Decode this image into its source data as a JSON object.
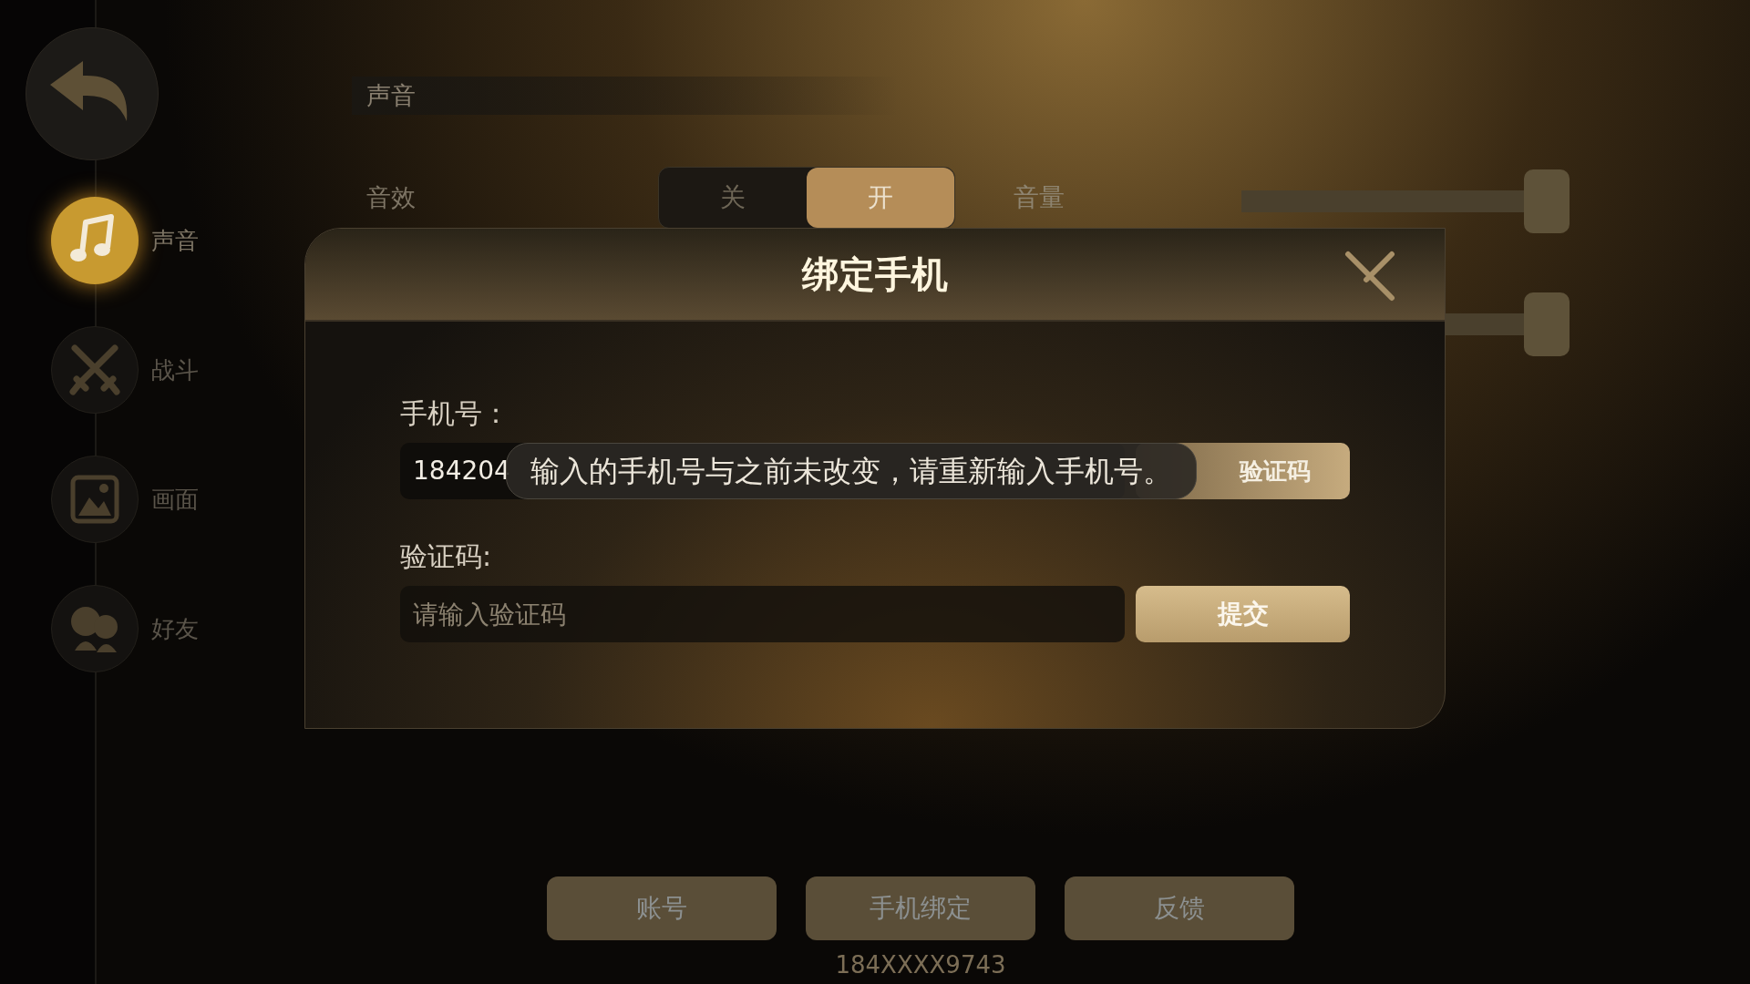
{
  "sidebar": {
    "items": [
      {
        "label": "声音",
        "kind": "music",
        "selected": true
      },
      {
        "label": "战斗",
        "kind": "swords",
        "selected": false
      },
      {
        "label": "画面",
        "kind": "image",
        "selected": false
      },
      {
        "label": "好友",
        "kind": "friends",
        "selected": false
      }
    ]
  },
  "settings": {
    "section_title": "声音",
    "sound_effects": {
      "label": "音效",
      "options": [
        {
          "label": "关",
          "selected": false
        },
        {
          "label": "开",
          "selected": true
        }
      ]
    },
    "volume_label": "音量",
    "sliders": [
      {
        "level": 1
      },
      {
        "level": 1
      }
    ]
  },
  "dialog": {
    "title": "绑定手机",
    "phone_label": "手机号：",
    "phone_value": "184204",
    "get_code_button": "验证码",
    "toast": "输入的手机号与之前未改变，请重新输入手机号。",
    "code_label": "验证码:",
    "code_placeholder": "请输入验证码",
    "submit_button": "提交"
  },
  "bottom_buttons": [
    "账号",
    "手机绑定",
    "反馈"
  ],
  "bound_phone": "184XXXX9743"
}
